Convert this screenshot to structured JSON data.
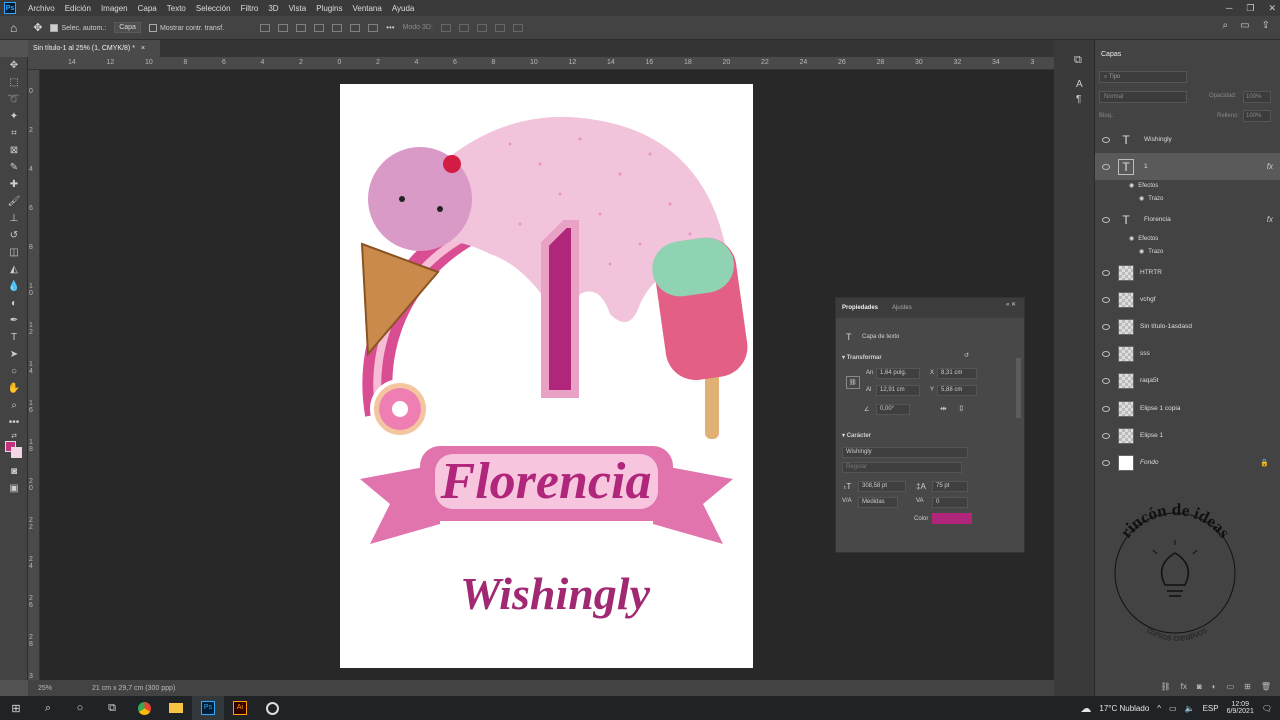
{
  "menubar": {
    "app_icon": "Ps",
    "items": [
      "Archivo",
      "Edición",
      "Imagen",
      "Capa",
      "Texto",
      "Selección",
      "Filtro",
      "3D",
      "Vista",
      "Plugins",
      "Ventana",
      "Ayuda"
    ]
  },
  "options": {
    "auto_select": "Selec. autom.:",
    "auto_select_value": "Capa",
    "show_transform": "Mostrar contr. transf.",
    "mode_3d": "Modo 3D:"
  },
  "tab": {
    "title": "Sin título-1 al 25% (1, CMYK/8) *",
    "close": "×"
  },
  "ruler": {
    "top": [
      "14",
      "12",
      "10",
      "8",
      "6",
      "4",
      "2",
      "0",
      "2",
      "4",
      "6",
      "8",
      "10",
      "12",
      "14",
      "16",
      "18",
      "20",
      "22",
      "24",
      "26",
      "28",
      "30",
      "32",
      "34",
      "3"
    ],
    "left": [
      "0",
      "2",
      "4",
      "6",
      "8",
      "1\n0",
      "1\n2",
      "1\n4",
      "1\n6",
      "1\n8",
      "2\n0",
      "2\n2",
      "2\n4",
      "2\n6",
      "2\n8",
      "3"
    ]
  },
  "artwork": {
    "number": "1",
    "name": "Florencia",
    "tagline": "Wishingly"
  },
  "status": {
    "zoom": "25%",
    "doc_size": "21 cm x 29,7 cm (300 ppp)"
  },
  "layers_panel": {
    "title": "Capas",
    "filter_placeholder": "Tipo",
    "blend_mode": "Normal",
    "opacity_label": "Opacidad:",
    "opacity_value": "100%",
    "lock_label": "Bloq.:",
    "fill_label": "Relleno:",
    "fill_value": "100%",
    "layers": [
      {
        "name": "Wishingly",
        "kind": "text"
      },
      {
        "name": "1",
        "kind": "text",
        "fx": "fx",
        "selected": true
      },
      {
        "name": "Florencia",
        "kind": "text",
        "fx": "fx"
      },
      {
        "name": "HTRTR",
        "kind": "image"
      },
      {
        "name": "vchgf",
        "kind": "image"
      },
      {
        "name": "Sin título-1asdasd",
        "kind": "image"
      },
      {
        "name": "sss",
        "kind": "image"
      },
      {
        "name": "raqa5t",
        "kind": "image"
      },
      {
        "name": "Elipse 1 copia",
        "kind": "image"
      },
      {
        "name": "Elipse 1",
        "kind": "image"
      },
      {
        "name": "Fondo",
        "kind": "background"
      }
    ],
    "effects_label": "Efectos",
    "stroke_label": "Trazo"
  },
  "properties": {
    "tab_active": "Propiedades",
    "tab_other": "Ajustes",
    "layer_type": "Capa de texto",
    "transform_label": "Transformar",
    "w_label": "An",
    "w_value": "1,64 pulg.",
    "x_label": "X",
    "x_value": "8,31 cm",
    "h_label": "Al",
    "h_value": "12,91 cm",
    "y_label": "Y",
    "y_value": "5,88 cm",
    "angle_value": "0,00°",
    "character_label": "Carácter",
    "font": "Wishingly",
    "style": "Regular",
    "size_value": "308,58 pt",
    "leading_value": "75 pt",
    "kerning_value": "Medidas",
    "tracking_value": "0",
    "color_label": "Color",
    "color_value": "#b0267a"
  },
  "watermark": {
    "title": "rincón de ideas",
    "subtitle": "cursos creativos"
  },
  "taskbar": {
    "weather": "17°C Nublado",
    "lang": "ESP",
    "time": "12:09",
    "date": "6/9/2021"
  }
}
